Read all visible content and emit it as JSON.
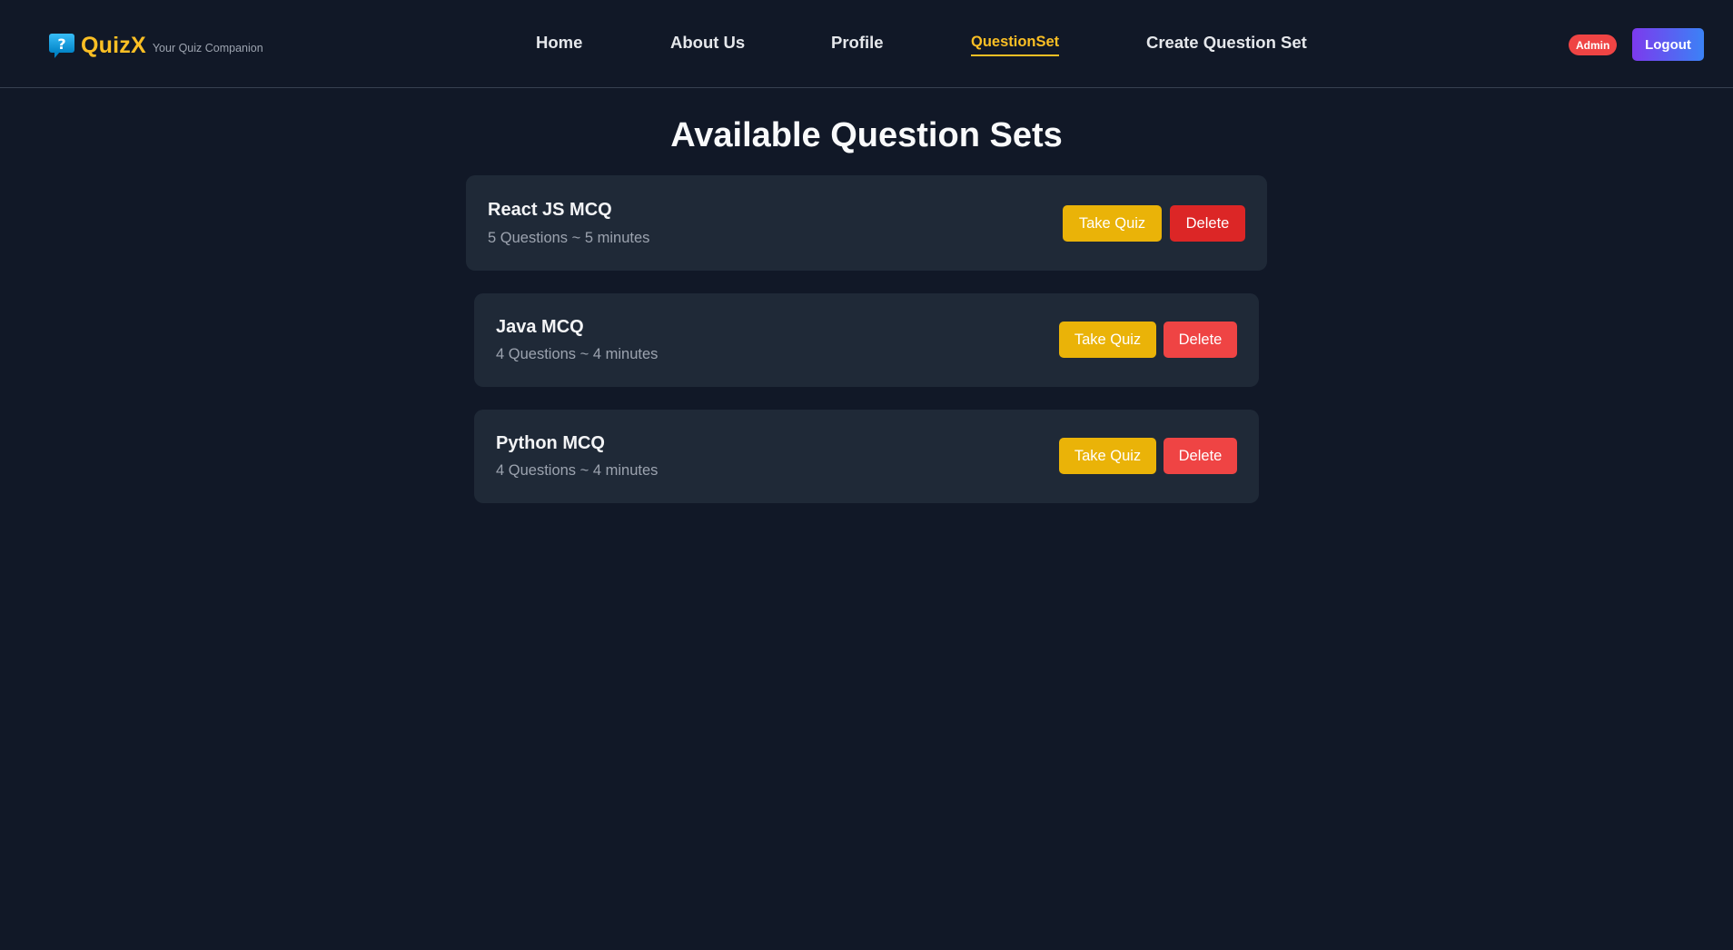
{
  "brand": {
    "name": "QuizX",
    "tagline": "Your Quiz Companion",
    "icon": "question-chat-icon"
  },
  "nav": {
    "items": [
      {
        "label": "Home",
        "active": false
      },
      {
        "label": "About Us",
        "active": false
      },
      {
        "label": "Profile",
        "active": false
      },
      {
        "label": "QuestionSet",
        "active": true
      },
      {
        "label": "Create Question Set",
        "active": false
      }
    ],
    "role_badge": "Admin",
    "logout_label": "Logout"
  },
  "main": {
    "title": "Available Question Sets",
    "sets": [
      {
        "title": "React JS MCQ",
        "meta": "5 Questions ~ 5 minutes",
        "take_label": "Take Quiz",
        "delete_label": "Delete"
      },
      {
        "title": "Java MCQ",
        "meta": "4 Questions ~ 4 minutes",
        "take_label": "Take Quiz",
        "delete_label": "Delete"
      },
      {
        "title": "Python MCQ",
        "meta": "4 Questions ~ 4 minutes",
        "take_label": "Take Quiz",
        "delete_label": "Delete"
      }
    ]
  },
  "colors": {
    "background": "#111827",
    "card": "#1f2937",
    "accent": "#fbbf24",
    "take_button": "#eab308",
    "delete_button": "#ef4444"
  }
}
